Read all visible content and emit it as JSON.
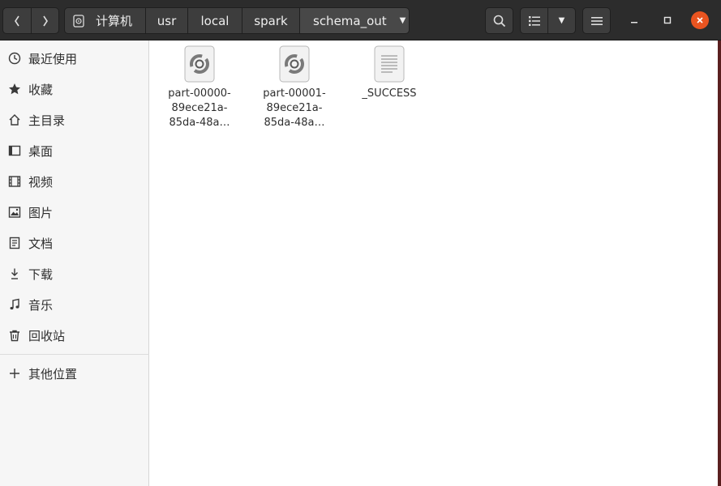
{
  "header": {
    "breadcrumbs": [
      "计算机",
      "usr",
      "local",
      "spark",
      "schema_out"
    ]
  },
  "sidebar": {
    "items": [
      {
        "label": "最近使用",
        "icon": "clock-icon"
      },
      {
        "label": "收藏",
        "icon": "star-icon"
      },
      {
        "label": "主目录",
        "icon": "home-icon"
      },
      {
        "label": "桌面",
        "icon": "desktop-icon"
      },
      {
        "label": "视频",
        "icon": "video-icon"
      },
      {
        "label": "图片",
        "icon": "picture-icon"
      },
      {
        "label": "文档",
        "icon": "document-icon"
      },
      {
        "label": "下载",
        "icon": "download-icon"
      },
      {
        "label": "音乐",
        "icon": "music-icon"
      },
      {
        "label": "回收站",
        "icon": "trash-icon"
      }
    ],
    "other_locations": {
      "label": "其他位置",
      "icon": "plus-icon"
    }
  },
  "files": [
    {
      "line1": "part-00000-",
      "line2": "89ece21a-",
      "line3": "85da-48a…",
      "icon": "parquet-file-icon"
    },
    {
      "line1": "part-00001-",
      "line2": "89ece21a-",
      "line3": "85da-48a…",
      "icon": "parquet-file-icon"
    },
    {
      "line1": "_SUCCESS",
      "line2": "",
      "line3": "",
      "icon": "text-file-icon"
    }
  ],
  "colors": {
    "headerbar": "#2c2c2c",
    "close_button": "#e95420",
    "sidebar": "#f6f6f6"
  }
}
